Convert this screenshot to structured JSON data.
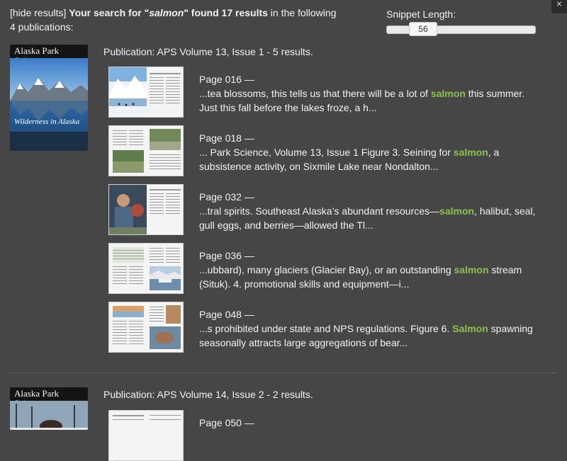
{
  "close_icon": "×",
  "summary": {
    "hide": "[hide results]",
    "pre": "Your search for \"",
    "term": "salmon",
    "post": "\" found 17 results",
    "tail": " in the following 4 publications:"
  },
  "snippet": {
    "label": "Snippet Length:",
    "value": "56"
  },
  "pub1": {
    "cover_title": "Alaska Park Science",
    "cover_subtitle": "Wilderness in Alaska",
    "header": "Publication: APS Volume 13, Issue 1 - 5 results.",
    "results": [
      {
        "page": "Page 016 —",
        "pre": "...tea blossoms, this tells us that there will be a lot of ",
        "hl": "salmon",
        "post": " this summer. Just this fall before the lakes froze, a h..."
      },
      {
        "page": "Page 018 —",
        "pre": "... Park Science, Volume 13, Issue 1 Figure 3. Seining for ",
        "hl": "salmon",
        "post": ", a subsistence activity, on Sixmile Lake near Nondalton..."
      },
      {
        "page": "Page 032 —",
        "pre": "...tral spirits. Southeast Alaska’s abundant resources—",
        "hl": "salmon",
        "post": ", halibut, seal, gull eggs, and berries—allowed the Tl..."
      },
      {
        "page": "Page 036 —",
        "pre": "...ubbard), many glaciers (Glacier Bay), or an outstanding ",
        "hl": "salmon",
        "post": " stream (Situk). 4. promotional skills and equipment—i..."
      },
      {
        "page": "Page 048 —",
        "pre": "...s prohibited under state and NPS regulations. Figure 6. ",
        "hl": "Salmon",
        "post": " spawning seasonally attracts large aggregations of bear..."
      }
    ]
  },
  "pub2": {
    "cover_title": "Alaska Park Science",
    "header": "Publication: APS Volume 14, Issue 2 - 2 results.",
    "results": [
      {
        "page": "Page 050 —"
      }
    ]
  }
}
